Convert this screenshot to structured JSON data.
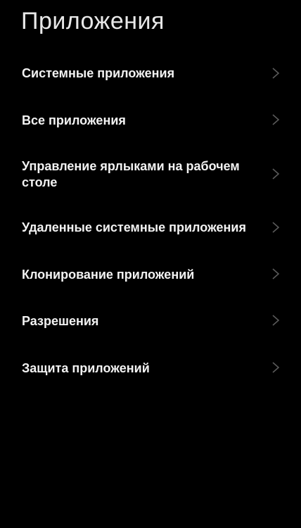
{
  "header": {
    "title": "Приложения"
  },
  "menu": {
    "items": [
      {
        "label": "Системные приложения",
        "icon": "chevron-right-icon"
      },
      {
        "label": "Все приложения",
        "icon": "chevron-right-icon"
      },
      {
        "label": "Управление ярлыками на рабочем столе",
        "icon": "chevron-right-icon"
      },
      {
        "label": "Удаленные системные приложения",
        "icon": "chevron-right-icon"
      },
      {
        "label": "Клонирование приложений",
        "icon": "chevron-right-icon"
      },
      {
        "label": "Разрешения",
        "icon": "chevron-right-icon"
      },
      {
        "label": "Защита приложений",
        "icon": "chevron-right-icon"
      }
    ]
  },
  "colors": {
    "background": "#000000",
    "text": "#f2f2f2",
    "chevron": "#5a5a5a"
  }
}
